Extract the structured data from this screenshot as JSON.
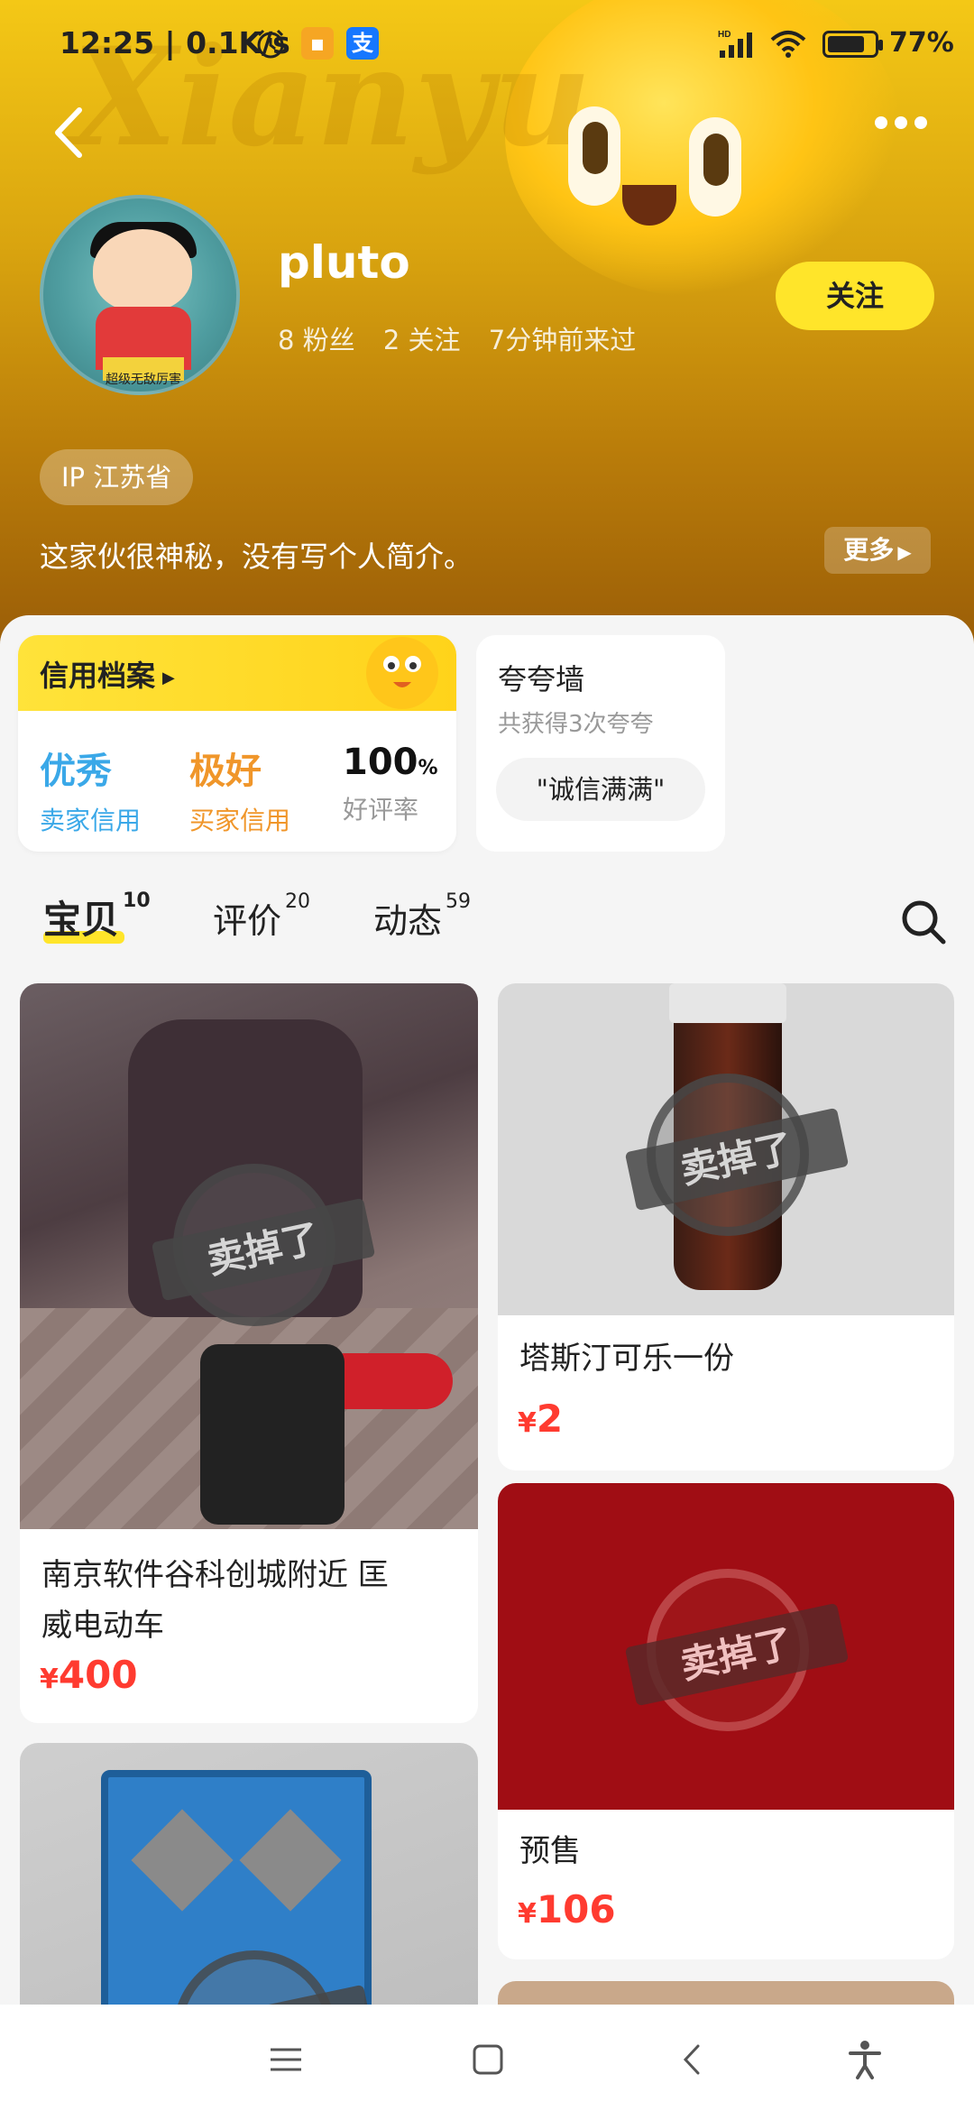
{
  "status_bar": {
    "time": "12:25 | 0.1K/s",
    "app_icon_label": "支",
    "battery": "77%",
    "battery_level": 0.77
  },
  "profile": {
    "username": "pluto",
    "followers": "8 粉丝",
    "following": "2 关注",
    "last_seen": "7分钟前来过",
    "follow_label": "关注",
    "ip_location": "IP 江苏省",
    "bio": "这家伙很神秘，没有写个人简介。",
    "more_label": "更多",
    "avatar_caption": "超级无敌厉害"
  },
  "credit": {
    "title": "信用档案",
    "seller_value": "优秀",
    "seller_label": "卖家信用",
    "buyer_value": "极好",
    "buyer_label": "买家信用",
    "rating_value": "100",
    "rating_unit": "%",
    "rating_label": "好评率"
  },
  "praise_wall": {
    "title": "夸夸墙",
    "subtitle": "共获得3次夸夸",
    "chip": "\"诚信满满\""
  },
  "tabs": [
    {
      "label": "宝贝",
      "count": "10",
      "active": true
    },
    {
      "label": "评价",
      "count": "20",
      "active": false
    },
    {
      "label": "动态",
      "count": "59",
      "active": false
    }
  ],
  "items": [
    {
      "title_line1": "南京软件谷科创城附近 匡",
      "title_line2": "威电动车",
      "price": "400",
      "sold_badge": "卖掉了"
    },
    {
      "title_line1": "塔斯汀可乐一份",
      "price": "2",
      "sold_badge": "卖掉了"
    },
    {
      "title_line1": "预售",
      "price": "106",
      "sold_badge": "卖掉了"
    },
    {
      "sold_badge": "卖掉了"
    }
  ],
  "currency": "¥",
  "colors": {
    "accent_yellow": "#ffe52a",
    "seller_blue": "#3aa8e8",
    "buyer_orange": "#f0962a",
    "price_red": "#ff3b30"
  }
}
